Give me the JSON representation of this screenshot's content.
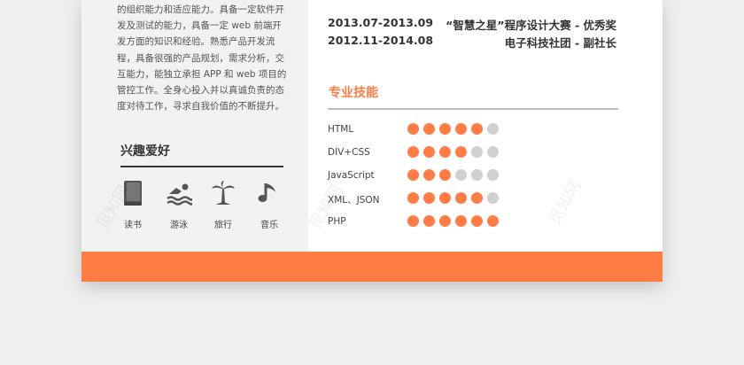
{
  "intro_lines": [
    "的组织能力和适应能力。具备一定软件开",
    "发及测试的能力，具备一定 web 前端开",
    "发方面的知识和经验。熟悉产品开发流",
    "程，具备很强的产品规划，需求分析，交",
    "互能力，能独立承担 APP 和 web 项目的",
    "管控工作。全身心投入并以真诚负责的态",
    "度对待工作，寻求自我价值的不断提升。"
  ],
  "hobbies": {
    "title": "兴趣爱好",
    "items": [
      {
        "icon": "book-icon",
        "label": "读书"
      },
      {
        "icon": "swimming-icon",
        "label": "游泳"
      },
      {
        "icon": "palm-tree-icon",
        "label": "旅行"
      },
      {
        "icon": "music-note-icon",
        "label": "音乐"
      }
    ]
  },
  "awards": [
    {
      "date": "2013.07-2013.09",
      "text": "“智慧之星”程序设计大赛 - 优秀奖"
    },
    {
      "date": "2012.11-2014.08",
      "text": "电子科技社团 - 副社长"
    }
  ],
  "skills": {
    "title": "专业技能",
    "max_level": 6,
    "items": [
      {
        "name": "HTML",
        "level": 5
      },
      {
        "name": "DIV+CSS",
        "level": 4
      },
      {
        "name": "JavaScript",
        "level": 3
      },
      {
        "name": "XML、JSON",
        "level": 5
      },
      {
        "name": "PHP",
        "level": 6
      }
    ]
  },
  "watermark": "觅知网",
  "colors": {
    "accent": "#ff7d45",
    "dot_empty": "#d0d0d0",
    "left_bg": "#f2f2f2",
    "icon": "#555555"
  }
}
